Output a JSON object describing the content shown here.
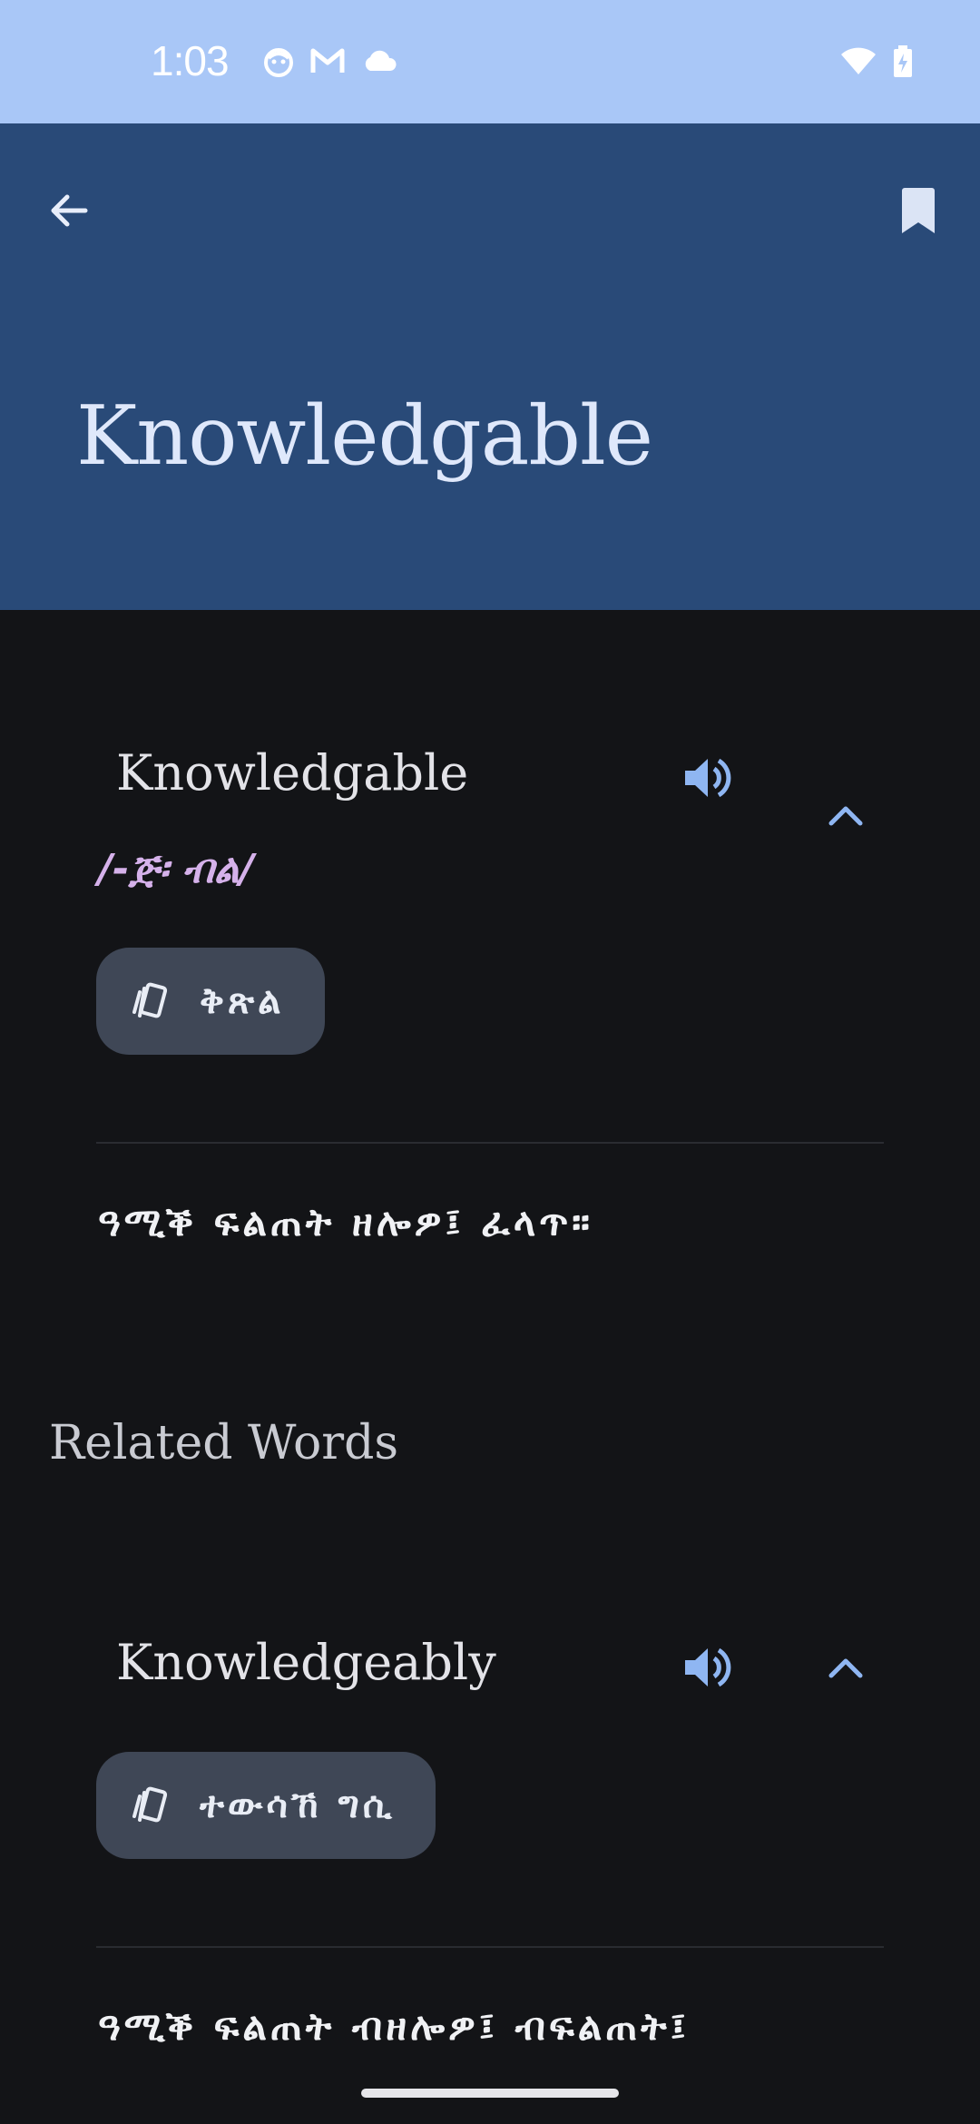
{
  "status_bar": {
    "time": "1:03",
    "icons_left": [
      "face-icon",
      "gmail-icon",
      "cloud-icon"
    ],
    "icons_right": [
      "wifi-icon",
      "battery-charging-icon"
    ]
  },
  "header": {
    "title": "Knowledgable",
    "back_icon": "arrow-back-icon",
    "bookmark_icon": "bookmark-icon",
    "background": "#294a78"
  },
  "main_entry": {
    "word": "Knowledgable",
    "pronunciation": "/-ጅ፡ ብል/",
    "part_of_speech": "ቅጽል",
    "definition": "ዓሚቕ ፍልጠት ዘሎዎ፤ ፈላጥ።"
  },
  "related_section": {
    "heading": "Related Words",
    "entries": [
      {
        "word": "Knowledgeably",
        "part_of_speech": "ተውሳኸ ግሲ",
        "definition": "ዓሚቕ ፍልጠት ብዘሎዎ፤ ብፍልጠት፤"
      }
    ]
  },
  "colors": {
    "accent": "#8fb6f2",
    "pronunciation": "#d5b1ea",
    "chip": "#3f4756",
    "background": "#131417"
  }
}
